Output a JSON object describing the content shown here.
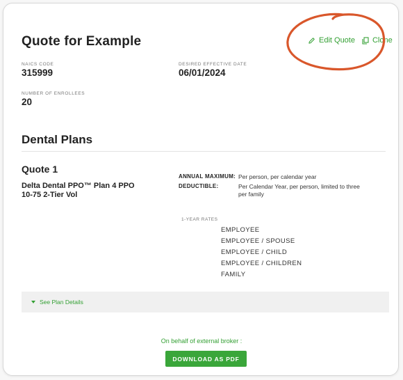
{
  "quote": {
    "title": "Quote for Example",
    "edit_label": "Edit Quote",
    "clone_label": "Clone"
  },
  "fields": {
    "naics_label": "NAICS CODE",
    "naics_value": "315999",
    "effective_label": "DESIRED EFFECTIVE DATE",
    "effective_value": "06/01/2024",
    "enrollees_label": "NUMBER OF ENROLLEES",
    "enrollees_value": "20"
  },
  "section": {
    "title": "Dental Plans",
    "quote_name": "Quote 1",
    "plan_name": "Delta Dental PPO™ Plan 4 PPO 10-75 2-Tier Vol",
    "annual_max_label": "ANNUAL MAXIMUM:",
    "annual_max_value": "Per person, per calendar year",
    "deductible_label": "DEDUCTIBLE:",
    "deductible_value": "Per Calendar Year, per person, limited to three per family",
    "rates_label": "1-YEAR RATES",
    "rates": [
      "EMPLOYEE",
      "EMPLOYEE / SPOUSE",
      "EMPLOYEE / CHILD",
      "EMPLOYEE / CHILDREN",
      "FAMILY"
    ],
    "see_details": "See Plan Details"
  },
  "footer": {
    "broker_text": "On behalf of external broker :",
    "download_label": "DOWNLOAD AS PDF"
  },
  "colors": {
    "accent": "#34a034",
    "button": "#3aa63a",
    "annotation": "#d9572b"
  },
  "icons": [
    "pencil-icon",
    "copy-icon",
    "caret-down-icon"
  ]
}
